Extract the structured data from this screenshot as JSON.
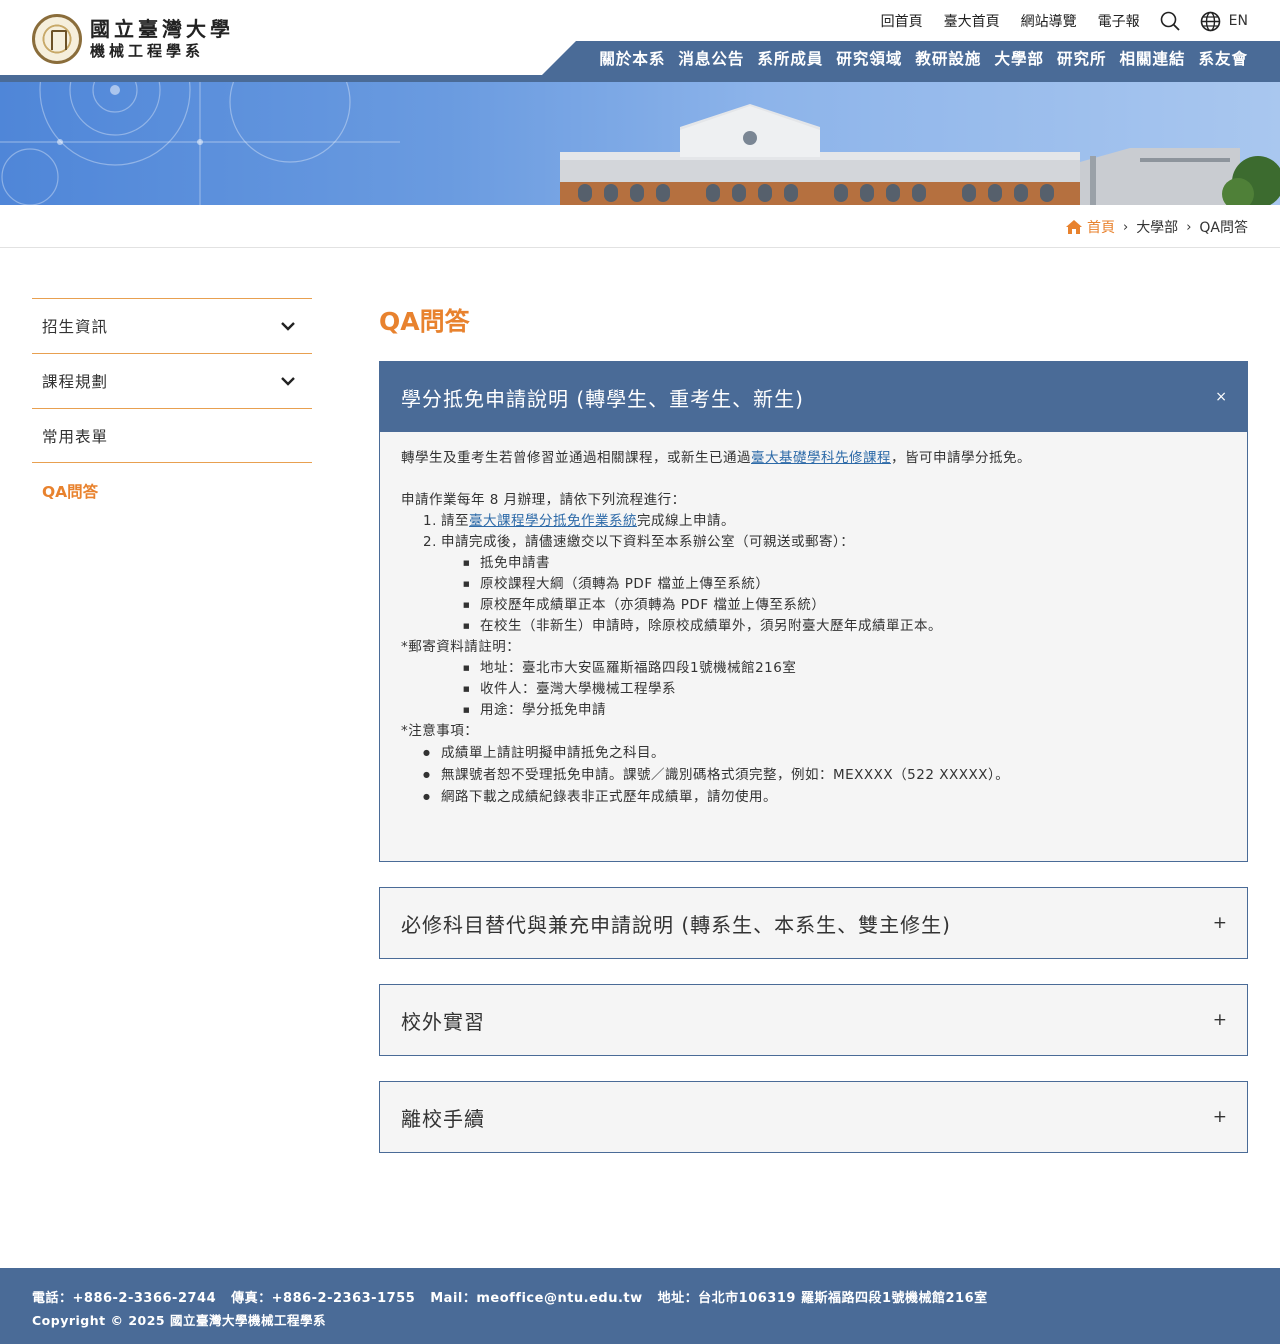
{
  "header": {
    "logo_university": "國立臺灣大學",
    "logo_department": "機械工程學系",
    "top_links": [
      "回首頁",
      "臺大首頁",
      "網站導覽",
      "電子報"
    ],
    "lang_label": "EN",
    "main_nav": [
      "關於本系",
      "消息公告",
      "系所成員",
      "研究領域",
      "教研設施",
      "大學部",
      "研究所",
      "相關連結",
      "系友會"
    ]
  },
  "breadcrumb": {
    "home": "首頁",
    "level1": "大學部",
    "current": "QA問答"
  },
  "sidebar": {
    "items": [
      {
        "label": "招生資訊",
        "expandable": true
      },
      {
        "label": "課程規劃",
        "expandable": true
      },
      {
        "label": "常用表單",
        "expandable": false
      }
    ],
    "active": "QA問答"
  },
  "main": {
    "title": "QA問答",
    "accordion": [
      {
        "title": "學分抵免申請說明 (轉學生、重考生、新生)",
        "state_symbol": "×",
        "open": true,
        "intro_before": "轉學生及重考生若曾修習並通過相關課程，或新生已通過",
        "intro_link": "臺大基礎學科先修課程",
        "intro_after": "，皆可申請學分抵免。",
        "process_intro": "申請作業每年 8 月辦理，請依下列流程進行：",
        "step1_num": "1.",
        "step1_before": "請至",
        "step1_link": "臺大課程學分抵免作業系統",
        "step1_after": "完成線上申請。",
        "step2_num": "2.",
        "step2_text": "申請完成後，請儘速繳交以下資料至本系辦公室（可親送或郵寄）：",
        "documents": [
          "抵免申請書",
          "原校課程大綱（須轉為 PDF 檔並上傳至系統）",
          "原校歷年成績單正本（亦須轉為 PDF 檔並上傳至系統）",
          "在校生（非新生）申請時，除原校成績單外，須另附臺大歷年成績單正本。"
        ],
        "mail_heading": "*郵寄資料請註明：",
        "mail_items": [
          "地址：臺北市大安區羅斯福路四段1號機械館216室",
          "收件人：臺灣大學機械工程學系",
          "用途：學分抵免申請"
        ],
        "notes_heading": "*注意事項：",
        "notes": [
          "成績單上請註明擬申請抵免之科目。",
          "無課號者恕不受理抵免申請。課號／識別碼格式須完整，例如：MEXXXX（522 XXXXX）。",
          "網路下載之成績紀錄表非正式歷年成績單，請勿使用。"
        ]
      },
      {
        "title": "必修科目替代與兼充申請說明 (轉系生、本系生、雙主修生)",
        "state_symbol": "+",
        "open": false
      },
      {
        "title": "校外實習",
        "state_symbol": "+",
        "open": false
      },
      {
        "title": "離校手續",
        "state_symbol": "+",
        "open": false
      }
    ]
  },
  "footer": {
    "phone": "電話：+886-2-3366-2744",
    "fax": "傳真：+886-2-2363-1755",
    "mail": "Mail：meoffice@ntu.edu.tw",
    "address": "地址：台北市106319 羅斯福路四段1號機械館216室",
    "copyright": "Copyright © 2025 國立臺灣大學機械工程學系"
  },
  "colors": {
    "primary_blue": "#4a6b97",
    "accent_orange": "#e8822e",
    "link_blue": "#2d6aa8"
  },
  "icons": [
    "search-icon",
    "globe-icon",
    "home-icon",
    "chevron-down-icon",
    "chevron-right-icon"
  ]
}
